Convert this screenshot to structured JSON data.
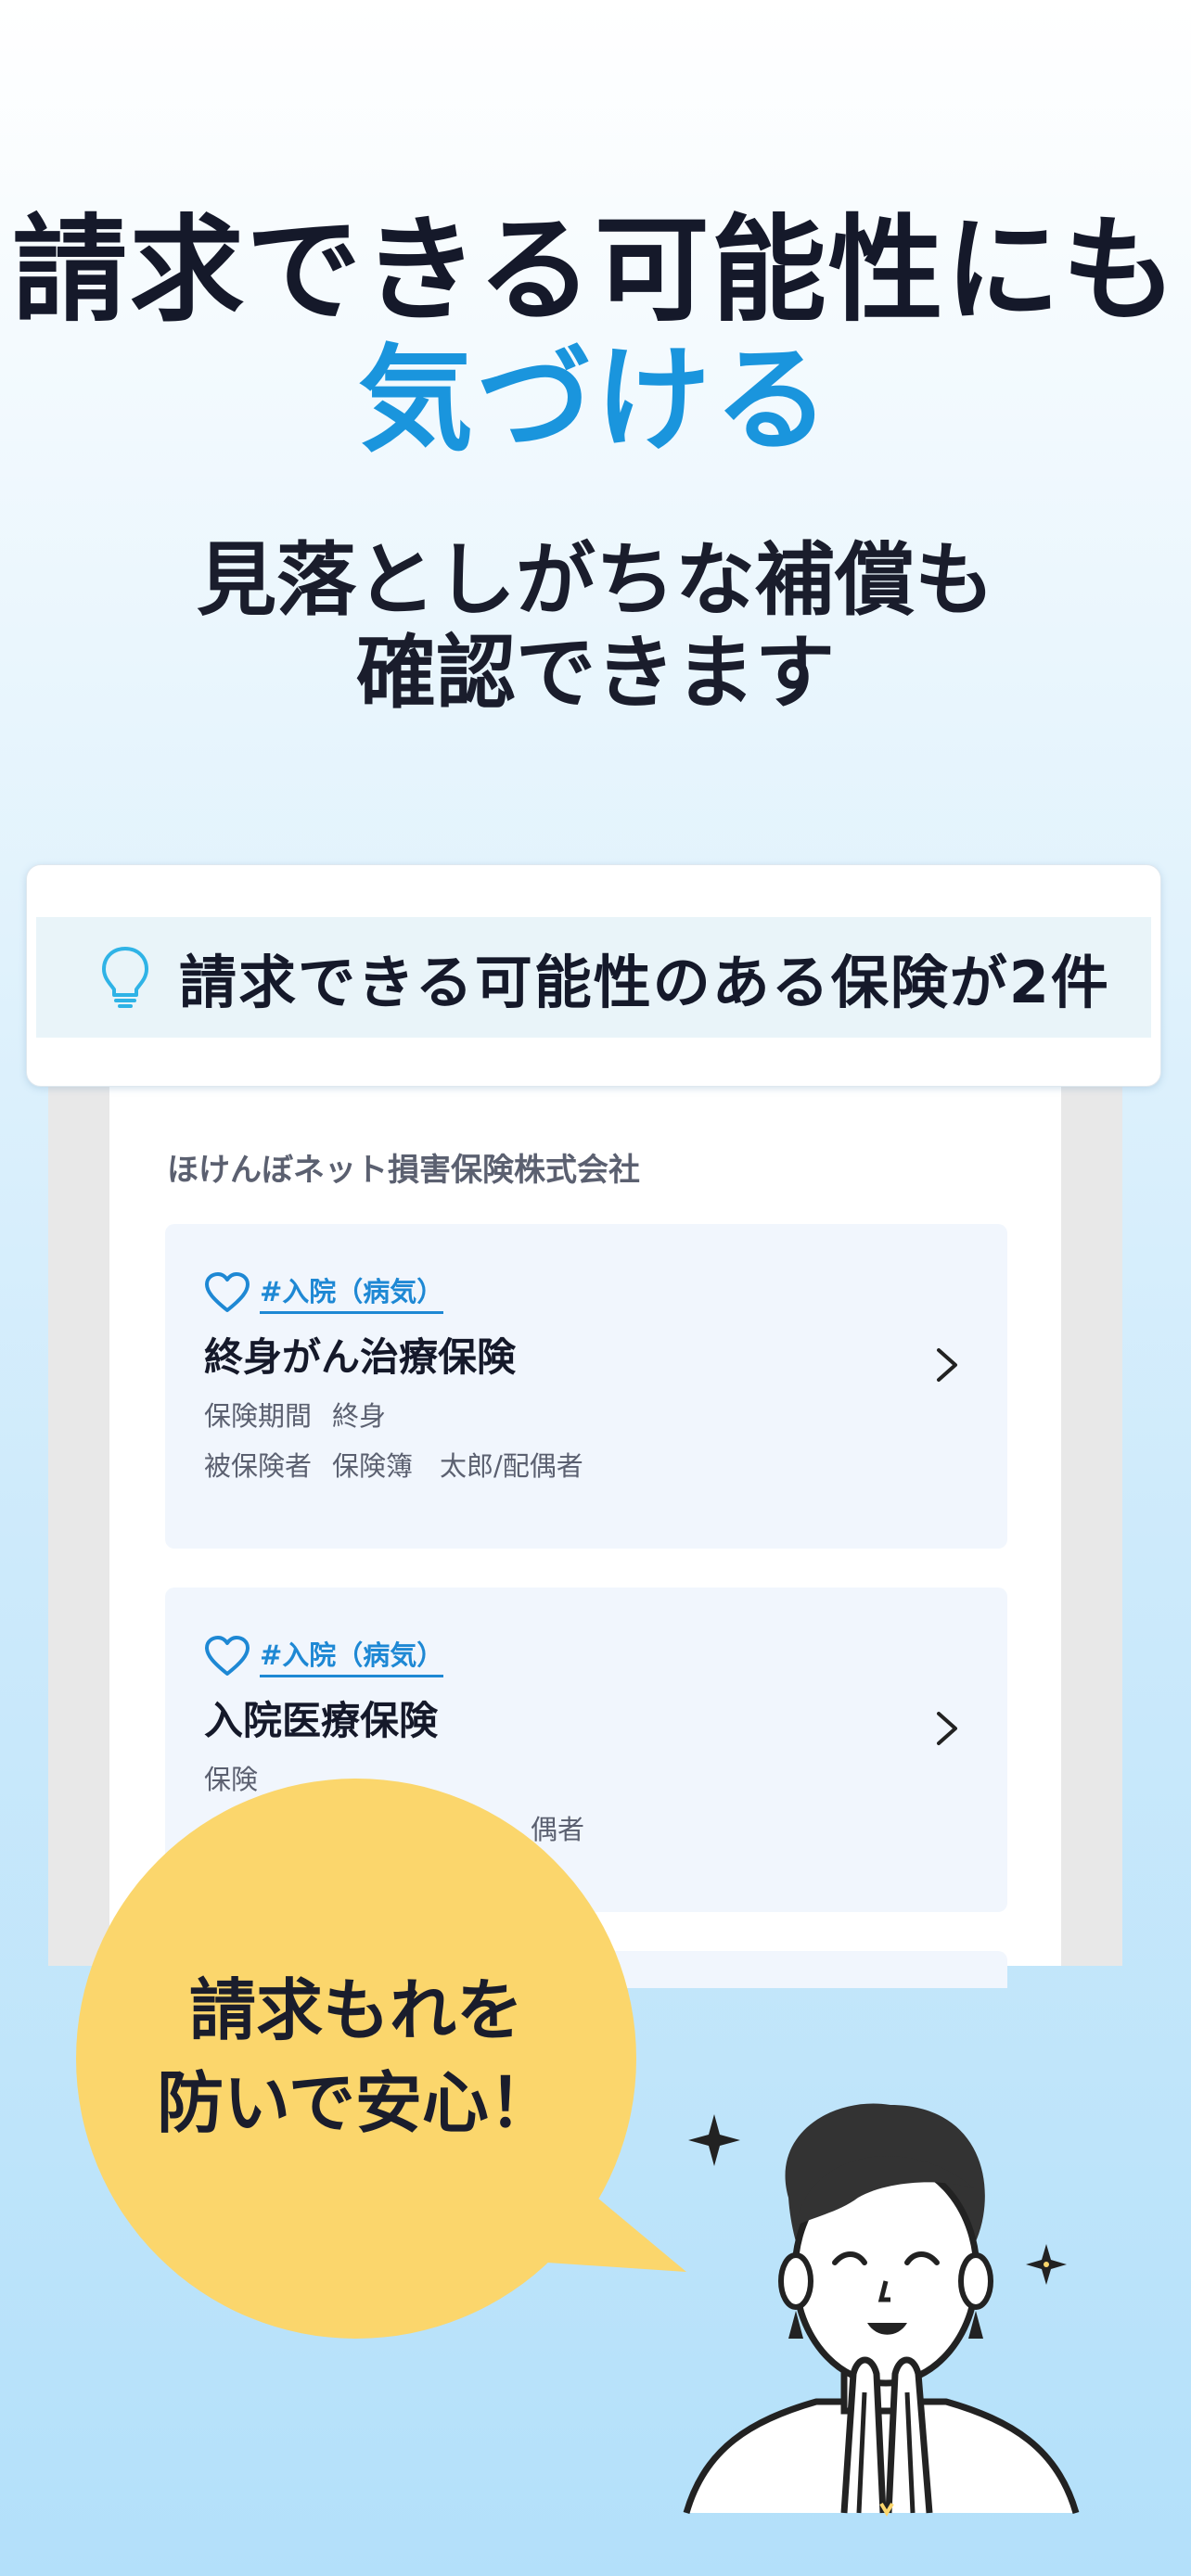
{
  "headline": {
    "line1": "請求できる可能性にも",
    "line2": "気づける",
    "sub_line1": "見落としがちな補償も",
    "sub_line2": "確認できます"
  },
  "banner": {
    "icon": "lightbulb-icon",
    "text": "請求できる可能性のある保険が2件"
  },
  "company": "ほけんぼネット損害保険株式会社",
  "policies": [
    {
      "tag": "#入院（病気）",
      "name": "終身がん治療保険",
      "period_label": "保険期間",
      "period_value": "終身",
      "insured_label": "被保険者",
      "insured_value": "保険簿　太郎/配偶者"
    },
    {
      "tag": "#入院（病気）",
      "name": "入院医療保険",
      "period_label": "保険",
      "insured_value": "偶者"
    }
  ],
  "bubble": {
    "line1": "請求もれを",
    "line2": "防いで安心！"
  },
  "colors": {
    "accent": "#1a95dd",
    "tag": "#1e88d4",
    "bubble": "#fbd66c",
    "card": "#f1f6fd"
  }
}
